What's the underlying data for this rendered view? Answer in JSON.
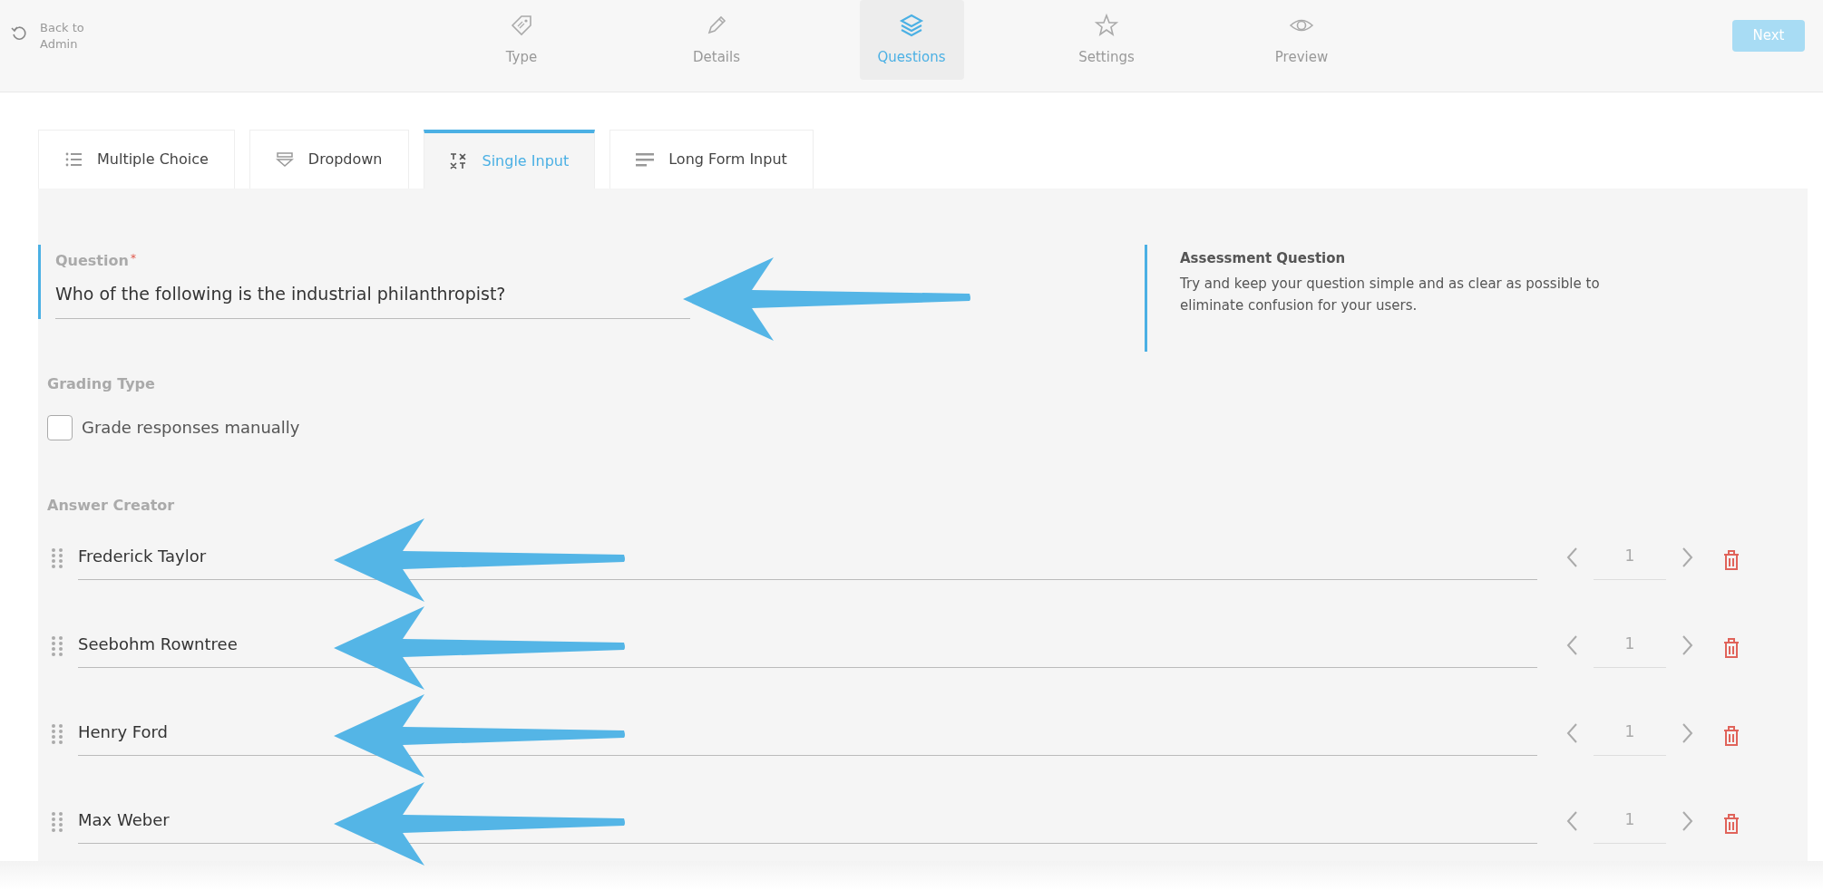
{
  "back_link": {
    "label": "Back to Admin"
  },
  "steps": [
    {
      "kind": "tag",
      "label": "Type",
      "selected": false
    },
    {
      "kind": "pencil",
      "label": "Details",
      "selected": false
    },
    {
      "kind": "layers",
      "label": "Questions",
      "selected": true
    },
    {
      "kind": "star",
      "label": "Settings",
      "selected": false
    },
    {
      "kind": "eye",
      "label": "Preview",
      "selected": false
    }
  ],
  "next_button": {
    "label": "Next",
    "disabled": true
  },
  "question_types": [
    {
      "kind": "list",
      "label": "Multiple Choice",
      "selected": false
    },
    {
      "kind": "dropdown",
      "label": "Dropdown",
      "selected": false
    },
    {
      "kind": "text",
      "label": "Single Input",
      "selected": true
    },
    {
      "kind": "lines",
      "label": "Long Form Input",
      "selected": false
    }
  ],
  "question": {
    "label": "Question",
    "required_mark": "*",
    "value": "Who of the following is the industrial philanthropist?",
    "arrow": true
  },
  "info": {
    "title": "Assessment Question",
    "text": "Try and keep your question simple and as clear as possible to eliminate confusion for your users."
  },
  "grading": {
    "title": "Grading Type",
    "checkbox": {
      "label": "Grade responses manually",
      "checked": false
    }
  },
  "answer_creator": {
    "title": "Answer Creator",
    "answers": [
      {
        "value": "Frederick Taylor",
        "points": "1",
        "arrow": true
      },
      {
        "value": "Seebohm Rowntree",
        "points": "1",
        "arrow": true
      },
      {
        "value": "Henry Ford",
        "points": "1",
        "arrow": true
      },
      {
        "value": "Max Weber",
        "points": "1",
        "arrow": true
      }
    ]
  }
}
